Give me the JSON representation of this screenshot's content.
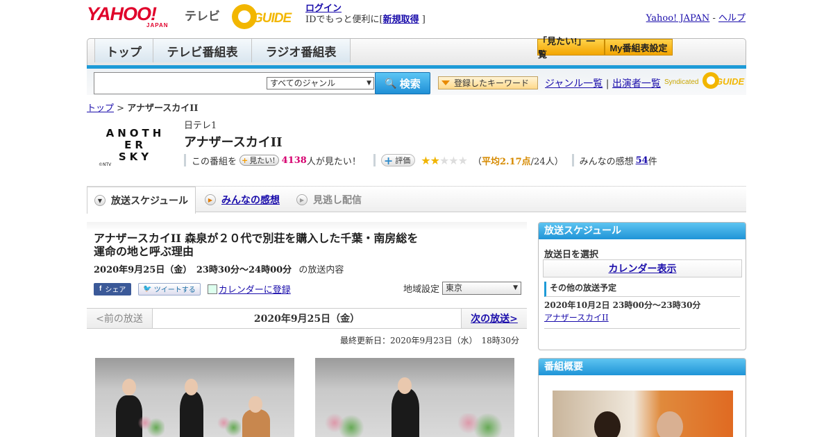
{
  "header": {
    "logo_text": "YAHOO!",
    "logo_sub": "JAPAN",
    "service": "テレビ",
    "gguide": "GUIDE",
    "login": "ログイン",
    "id_text": "IDでもっと便利に[",
    "signup": "新規取得",
    "id_close": "]",
    "yahoo_japan": "Yahoo! JAPAN",
    "dash": "-",
    "help": "ヘルプ"
  },
  "nav": {
    "tabs": [
      "トップ",
      "テレビ番組表",
      "ラジオ番組表"
    ],
    "mitai_list": "「見たい!」一覧",
    "my_schedule": "My番組表設定"
  },
  "search": {
    "genre": "すべてのジャンル",
    "button": "検索",
    "keywords": "登録したキーワード",
    "genre_list": "ジャンル一覧",
    "pipe": "|",
    "performers": "出演者一覧",
    "syndicated": "Syndicated"
  },
  "breadcrumb": {
    "home": "トップ",
    "sep": ">",
    "current": "アナザースカイII"
  },
  "program": {
    "logo_lines": [
      "ANOTH",
      "ER",
      "SKY"
    ],
    "logo_copy": "©NTV",
    "channel": "日テレ1",
    "title": "アナザースカイII",
    "prefix": "この番組を",
    "mitai_btn": "見たい!",
    "mitai_count": "4138",
    "mitai_suffix": "人が見たい！",
    "rate_btn": "評価",
    "rating": 2,
    "rating_max": 5,
    "avg_open": "（",
    "avg_label": "平均2.17点",
    "avg_rest": "/24人）",
    "impressions_label": "みんなの感想",
    "impressions_count": "54",
    "impressions_unit": "件"
  },
  "tabs2": [
    "放送スケジュール",
    "みんなの感想",
    "見逃し配信"
  ],
  "episode": {
    "title": "アナザースカイII 森泉が２０代で別荘を購入した千葉・南房総を運命の地と呼ぶ理由",
    "date": "2020年9月25日（金）　23時30分～24時00分",
    "date_suffix": "の放送内容",
    "fb": "シェア",
    "tweet": "ツイートする",
    "calendar": "カレンダーに登録",
    "region_label": "地域設定",
    "region": "東京"
  },
  "pager": {
    "prev": "<前の放送",
    "current": "2020年9月25日（金）",
    "next": "次の放送>",
    "updated": "最終更新日：2020年9月23日（水）　18時30分"
  },
  "sidebar": {
    "schedule_title": "放送スケジュール",
    "select_date": "放送日を選択",
    "calendar_btn": "カレンダー表示",
    "other_title": "その他の放送予定",
    "other_date": "2020年10月2日  23時00分～23時30分",
    "other_link": "アナザースカイII",
    "overview_title": "番組概要"
  },
  "colors": {
    "accent": "#1e9bd7",
    "brand": "#e0002a",
    "gguide": "#f2b600",
    "star": "#f0b400"
  }
}
